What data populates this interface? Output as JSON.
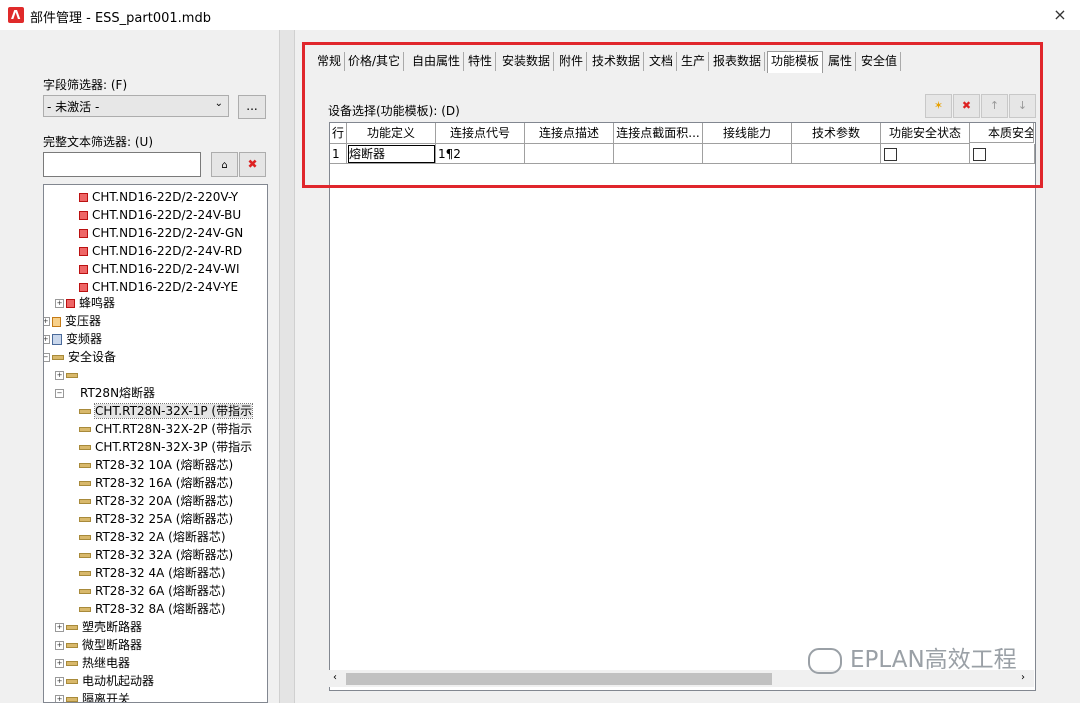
{
  "window": {
    "title": "部件管理 - ESS_part001.mdb",
    "close_label": "×"
  },
  "left_panel": {
    "field_filter_label": "字段筛选器: (F)",
    "field_filter_value": "- 未激活 -",
    "field_filter_more": "...",
    "fulltext_label": "完整文本筛选器: (U)",
    "fulltext_value": "",
    "tree": [
      {
        "label": "CHT.ND16-22D/2-220V-Y",
        "icon": "red-part-icon"
      },
      {
        "label": "CHT.ND16-22D/2-24V-BU",
        "icon": "red-part-icon"
      },
      {
        "label": "CHT.ND16-22D/2-24V-GN",
        "icon": "red-part-icon"
      },
      {
        "label": "CHT.ND16-22D/2-24V-RD",
        "icon": "red-part-icon"
      },
      {
        "label": "CHT.ND16-22D/2-24V-WI",
        "icon": "red-part-icon"
      },
      {
        "label": "CHT.ND16-22D/2-24V-YE",
        "icon": "red-part-icon"
      },
      {
        "label": "蜂鸣器",
        "icon": "red-part-icon"
      },
      {
        "label": "变压器",
        "icon": "transformer-icon"
      },
      {
        "label": "变频器",
        "icon": "inverter-icon"
      },
      {
        "label": "安全设备",
        "icon": "device-bar-icon"
      },
      {
        "label": "",
        "icon": "device-bar-icon"
      },
      {
        "label": "RT28N熔断器",
        "icon": ""
      },
      {
        "label": "CHT.RT28N-32X-1P (带指示",
        "icon": "device-bar-icon"
      },
      {
        "label": "CHT.RT28N-32X-2P (带指示",
        "icon": "device-bar-icon"
      },
      {
        "label": "CHT.RT28N-32X-3P (带指示",
        "icon": "device-bar-icon"
      },
      {
        "label": "RT28-32 10A (熔断器芯)",
        "icon": "device-bar-icon"
      },
      {
        "label": "RT28-32 16A (熔断器芯)",
        "icon": "device-bar-icon"
      },
      {
        "label": "RT28-32 20A (熔断器芯)",
        "icon": "device-bar-icon"
      },
      {
        "label": "RT28-32 25A (熔断器芯)",
        "icon": "device-bar-icon"
      },
      {
        "label": "RT28-32 2A (熔断器芯)",
        "icon": "device-bar-icon"
      },
      {
        "label": "RT28-32 32A (熔断器芯)",
        "icon": "device-bar-icon"
      },
      {
        "label": "RT28-32 4A (熔断器芯)",
        "icon": "device-bar-icon"
      },
      {
        "label": "RT28-32 6A (熔断器芯)",
        "icon": "device-bar-icon"
      },
      {
        "label": "RT28-32 8A (熔断器芯)",
        "icon": "device-bar-icon"
      },
      {
        "label": "塑壳断路器",
        "icon": "device-bar-icon"
      },
      {
        "label": "微型断路器",
        "icon": "device-bar-icon"
      },
      {
        "label": "热继电器",
        "icon": "device-bar-icon"
      },
      {
        "label": "电动机起动器",
        "icon": "device-bar-icon"
      },
      {
        "label": "隔离开关",
        "icon": "device-bar-icon"
      }
    ]
  },
  "tabs": [
    "常规",
    "价格/其它",
    "自由属性",
    "特性",
    "安装数据",
    "附件",
    "技术数据",
    "文档",
    "生产",
    "报表数据",
    "功能模板",
    "属性",
    "安全值"
  ],
  "active_tab": "功能模板",
  "function_template": {
    "section_label": "设备选择(功能模板): (D)",
    "columns": [
      "行",
      "功能定义",
      "连接点代号",
      "连接点描述",
      "连接点截面积...",
      "接线能力",
      "技术参数",
      "功能安全状态",
      "本质安全"
    ],
    "rows": [
      {
        "row": "1",
        "function": "熔断器",
        "conn_code": "1¶2",
        "conn_desc": "",
        "cross_section": "",
        "wiring": "",
        "tech_params": "",
        "func_safety": false,
        "intrinsic_safety": false
      }
    ],
    "toolbar": [
      "new-icon",
      "delete-icon",
      "move-up-icon",
      "move-down-icon"
    ],
    "colors": {
      "highlight": "#e0262c"
    }
  },
  "watermark": "EPLAN高效工程"
}
